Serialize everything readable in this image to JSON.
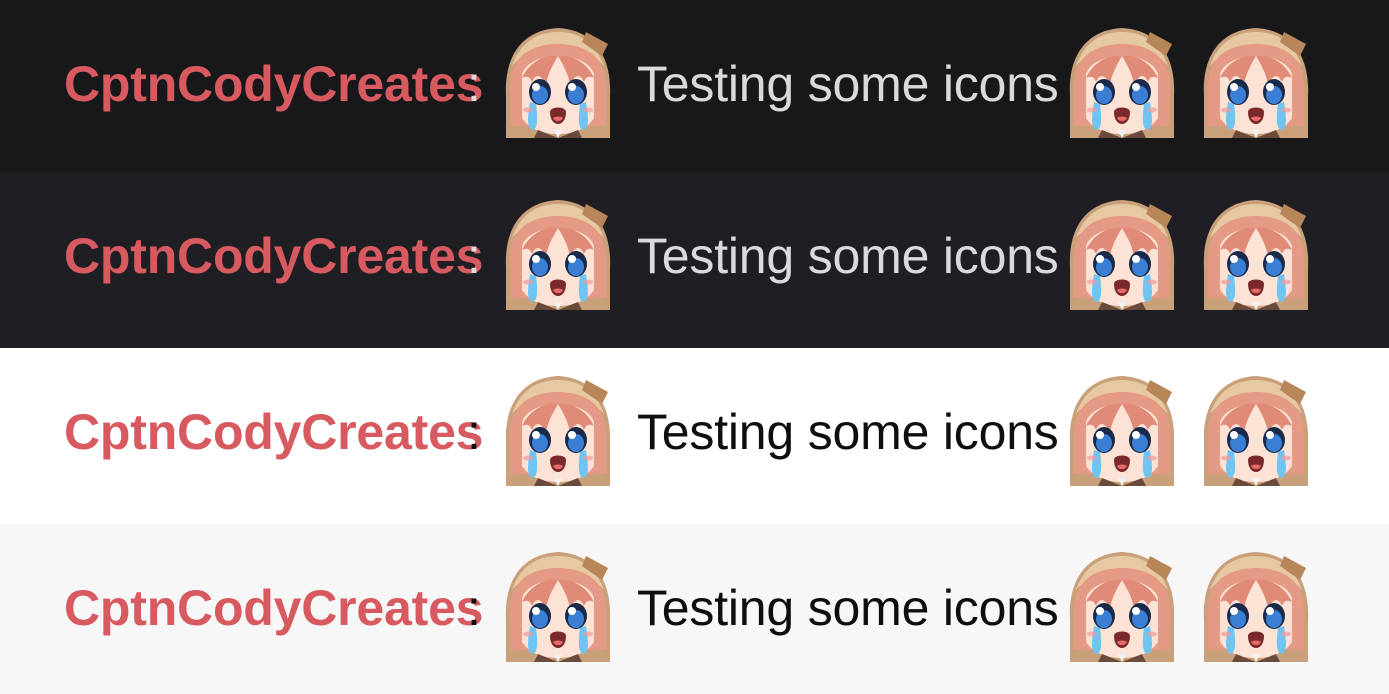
{
  "rows": [
    {
      "theme": "dark",
      "username": "CptnCodyCreates",
      "separator": ":",
      "message": "Testing some icons"
    },
    {
      "theme": "dark",
      "username": "CptnCodyCreates",
      "separator": ":",
      "message": "Testing some icons"
    },
    {
      "theme": "light",
      "username": "CptnCodyCreates",
      "separator": ":",
      "message": "Testing some icons"
    },
    {
      "theme": "light",
      "username": "CptnCodyCreates",
      "separator": ":",
      "message": "Testing some icons"
    }
  ],
  "emote": {
    "icon": "crying-anime-girl-emote-icon"
  },
  "colors": {
    "username": "#d65a5f",
    "dark_bg_1": "#18181b",
    "dark_bg_2": "#1f1f23",
    "light_bg_1": "#ffffff",
    "light_bg_2": "#f7f7f8",
    "dark_text": "#dadade",
    "light_text": "#0e0e10"
  }
}
